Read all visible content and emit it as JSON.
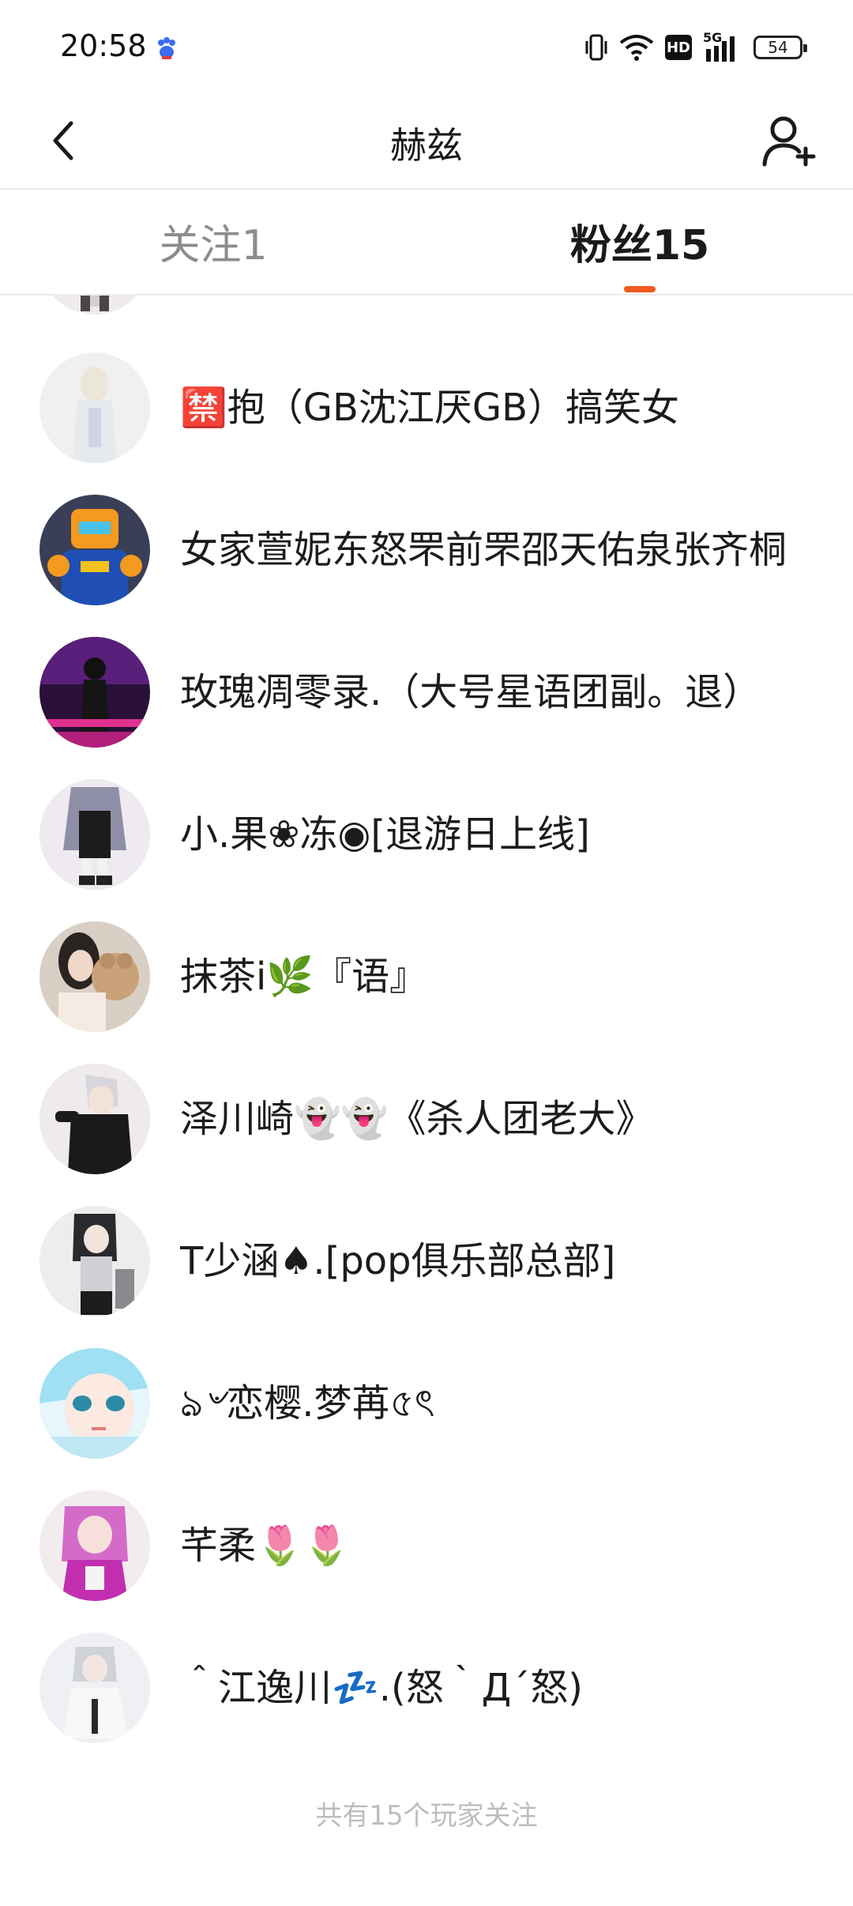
{
  "status_bar": {
    "time": "20:58",
    "network_badge": "HD",
    "signal_label": "5G",
    "battery": "54"
  },
  "header": {
    "title": "赫兹",
    "back_icon": "chevron-left-icon",
    "add_friend_icon": "add-user-icon"
  },
  "tabs": [
    {
      "label": "关注1",
      "active": false
    },
    {
      "label": "粉丝15",
      "active": true
    }
  ],
  "accent_color": "#f05a22",
  "fans": [
    {
      "name": ""
    },
    {
      "name": "🈲抱（GB沈江厌GB）搞笑女"
    },
    {
      "name": "女家萱妮东怒罘前罘邵天佑泉张齐桐"
    },
    {
      "name": "玫瑰凋零录.（大号星语团副。退）"
    },
    {
      "name": "小.果❀冻◉[退游日上线]"
    },
    {
      "name": "抹茶i🌿『语』"
    },
    {
      "name": "泽川崎👻👻《杀人团老大》"
    },
    {
      "name": "T少涵♠.[pop俱乐部总部]"
    },
    {
      "name": "ঌ৺恋樱.梦苒৫ৎ"
    },
    {
      "name": "芊柔🌷🌷"
    },
    {
      "name": "＾江逸川💤.(怒｀Д´怒)"
    }
  ],
  "footer": "共有15个玩家关注"
}
